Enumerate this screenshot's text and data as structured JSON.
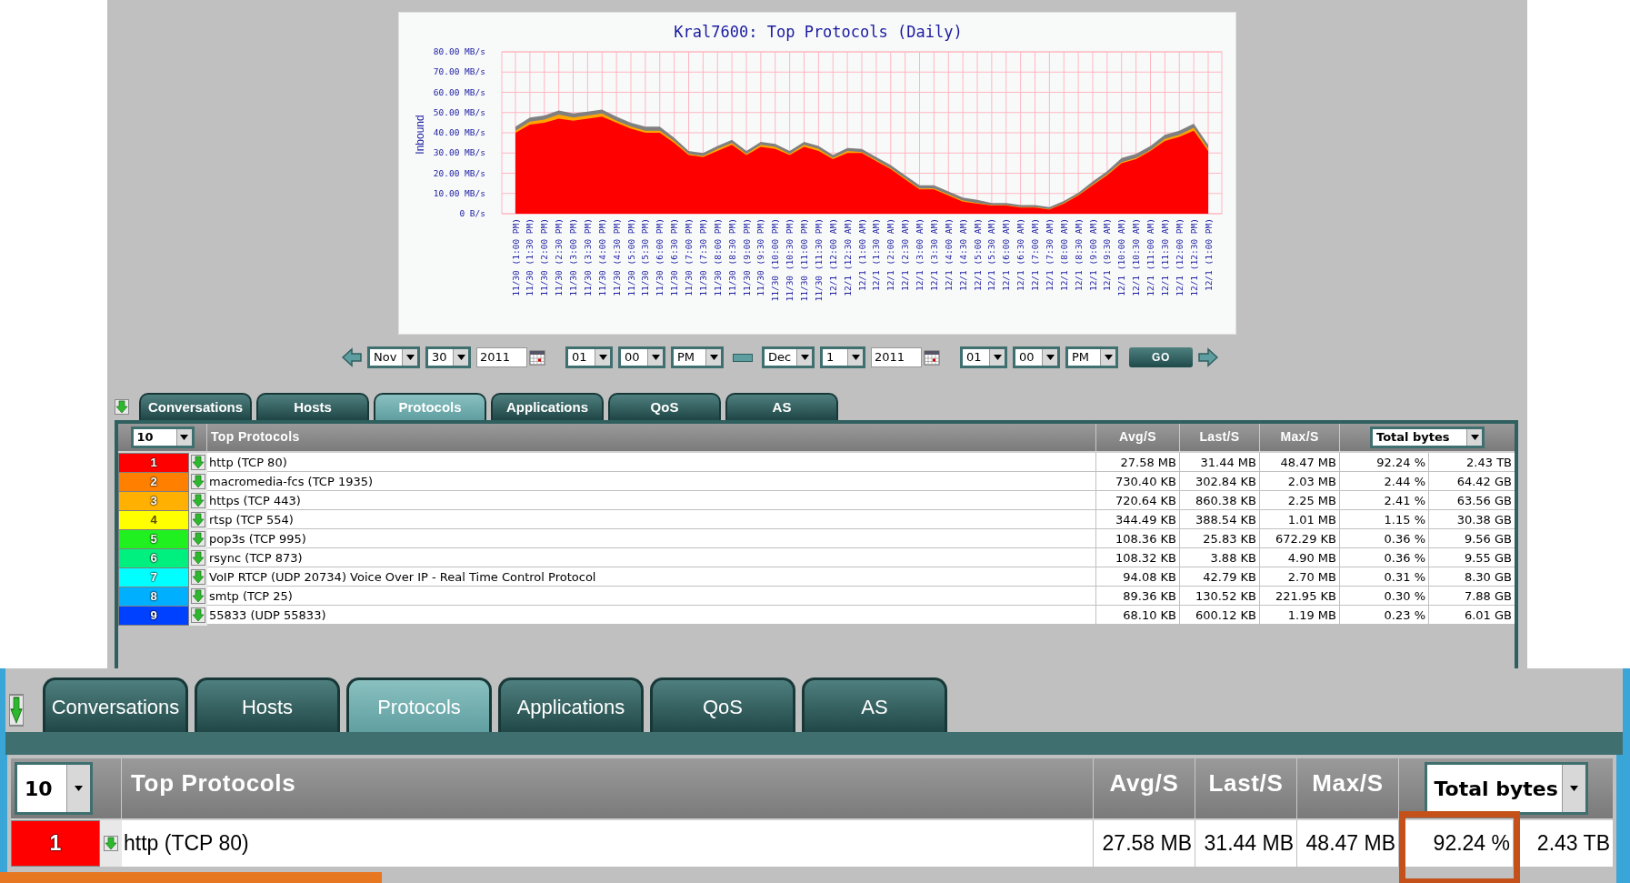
{
  "chart": {
    "chart_data": {
      "type": "area",
      "title": "Kral7600: Top Protocols (Daily)",
      "ylabel": "Inbound",
      "grid": true,
      "categories": [
        "11/30 (1:00 PM)",
        "11/30 (1:30 PM)",
        "11/30 (2:00 PM)",
        "11/30 (2:30 PM)",
        "11/30 (3:00 PM)",
        "11/30 (3:30 PM)",
        "11/30 (4:00 PM)",
        "11/30 (4:30 PM)",
        "11/30 (5:00 PM)",
        "11/30 (5:30 PM)",
        "11/30 (6:00 PM)",
        "11/30 (6:30 PM)",
        "11/30 (7:00 PM)",
        "11/30 (7:30 PM)",
        "11/30 (8:00 PM)",
        "11/30 (8:30 PM)",
        "11/30 (9:00 PM)",
        "11/30 (9:30 PM)",
        "11/30 (10:00 PM)",
        "11/30 (10:30 PM)",
        "11/30 (11:00 PM)",
        "11/30 (11:30 PM)",
        "12/1 (12:00 AM)",
        "12/1 (12:30 AM)",
        "12/1 (1:00 AM)",
        "12/1 (1:30 AM)",
        "12/1 (2:00 AM)",
        "12/1 (2:30 AM)",
        "12/1 (3:00 AM)",
        "12/1 (3:30 AM)",
        "12/1 (4:00 AM)",
        "12/1 (4:30 AM)",
        "12/1 (5:00 AM)",
        "12/1 (5:30 AM)",
        "12/1 (6:00 AM)",
        "12/1 (6:30 AM)",
        "12/1 (7:00 AM)",
        "12/1 (7:30 AM)",
        "12/1 (8:00 AM)",
        "12/1 (8:30 AM)",
        "12/1 (9:00 AM)",
        "12/1 (9:30 AM)",
        "12/1 (10:00 AM)",
        "12/1 (10:30 AM)",
        "12/1 (11:00 AM)",
        "12/1 (11:30 AM)",
        "12/1 (12:00 PM)",
        "12/1 (12:30 PM)",
        "12/1 (1:00 PM)"
      ],
      "series": [
        {
          "color": "#808080",
          "values": [
            43,
            47.5,
            48.5,
            51,
            49.5,
            50.5,
            51.5,
            48,
            45,
            43,
            43,
            37.5,
            31,
            30,
            33.5,
            36.5,
            31,
            35.5,
            34.5,
            31,
            35.5,
            33.5,
            29,
            32.5,
            32,
            28,
            24,
            19,
            14,
            14,
            11,
            8,
            6.8,
            5.3,
            5.3,
            4.3,
            4.3,
            3.3,
            6.3,
            10.3,
            16,
            21,
            27.5,
            29.5,
            33.5,
            39,
            41,
            44.5,
            34
          ]
        },
        {
          "color": "#ffa500",
          "values": [
            41,
            45.5,
            46.5,
            49,
            47.5,
            48.5,
            49.5,
            46,
            43,
            41,
            41,
            36,
            29.5,
            28.5,
            32,
            35,
            29.5,
            34,
            33,
            29.5,
            34,
            32,
            27.5,
            31,
            30.5,
            26.5,
            22.5,
            17.5,
            12.5,
            12.5,
            9.5,
            6.5,
            5.3,
            4.3,
            4.3,
            3.3,
            3.3,
            2.3,
            5.3,
            9.3,
            14.5,
            19.5,
            25.5,
            27.5,
            31.5,
            37,
            39,
            42.5,
            32
          ]
        },
        {
          "color": "#ff0000",
          "values": [
            40,
            44,
            45,
            47,
            46,
            47,
            48,
            45,
            42,
            40,
            40,
            35,
            29,
            28,
            31,
            34,
            29,
            33,
            32,
            29,
            33,
            31,
            27,
            30,
            30,
            26,
            22,
            17,
            12,
            12,
            9,
            6,
            5,
            4,
            4,
            3,
            3,
            2,
            5,
            9,
            14,
            19,
            25,
            27,
            31,
            36,
            38,
            41,
            31
          ]
        }
      ],
      "ylim": [
        0,
        80
      ],
      "yticks": [
        {
          "value": 0,
          "label": "0 B/s"
        },
        {
          "value": 10,
          "label": "10.00 MB/s"
        },
        {
          "value": 20,
          "label": "20.00 MB/s"
        },
        {
          "value": 30,
          "label": "30.00 MB/s"
        },
        {
          "value": 40,
          "label": "40.00 MB/s"
        },
        {
          "value": 50,
          "label": "50.00 MB/s"
        },
        {
          "value": 60,
          "label": "60.00 MB/s"
        },
        {
          "value": 70,
          "label": "70.00 MB/s"
        },
        {
          "value": 80,
          "label": "80.00 MB/s"
        }
      ]
    }
  },
  "date_range": {
    "start": {
      "month": "Nov",
      "day": "30",
      "year": "2011",
      "hour": "01",
      "minute": "00",
      "ampm": "PM"
    },
    "end": {
      "month": "Dec",
      "day": "1",
      "year": "2011",
      "hour": "01",
      "minute": "00",
      "ampm": "PM"
    },
    "go": "GO"
  },
  "tabs": [
    {
      "label": "Conversations",
      "selected": false
    },
    {
      "label": "Hosts",
      "selected": false
    },
    {
      "label": "Protocols",
      "selected": true
    },
    {
      "label": "Applications",
      "selected": false
    },
    {
      "label": "QoS",
      "selected": false
    },
    {
      "label": "AS",
      "selected": false
    }
  ],
  "table": {
    "rows_select": "10",
    "title": "Top Protocols",
    "columns": [
      "Avg/S",
      "Last/S",
      "Max/S"
    ],
    "sort_select": "Total bytes",
    "rows": [
      {
        "rank": "1",
        "color": "#ff0000",
        "name": "http (TCP 80)",
        "avg": "27.58 MB",
        "last": "31.44 MB",
        "max": "48.47 MB",
        "percent": "92.24 %",
        "total": "2.43 TB"
      },
      {
        "rank": "2",
        "color": "#ff8000",
        "name": "macromedia-fcs (TCP 1935)",
        "avg": "730.40 KB",
        "last": "302.84 KB",
        "max": "2.03 MB",
        "percent": "2.44 %",
        "total": "64.42 GB"
      },
      {
        "rank": "3",
        "color": "#ffb000",
        "name": "https (TCP 443)",
        "avg": "720.64 KB",
        "last": "860.38 KB",
        "max": "2.25 MB",
        "percent": "2.41 %",
        "total": "63.56 GB"
      },
      {
        "rank": "4",
        "color": "#ffff00",
        "name": "rtsp (TCP 554)",
        "avg": "344.49 KB",
        "last": "388.54 KB",
        "max": "1.01 MB",
        "percent": "1.15 %",
        "total": "30.38 GB"
      },
      {
        "rank": "5",
        "color": "#20f020",
        "name": "pop3s (TCP 995)",
        "avg": "108.36 KB",
        "last": "25.83 KB",
        "max": "672.29 KB",
        "percent": "0.36 %",
        "total": "9.56 GB"
      },
      {
        "rank": "6",
        "color": "#00f080",
        "name": "rsync (TCP 873)",
        "avg": "108.32 KB",
        "last": "3.88 KB",
        "max": "4.90 MB",
        "percent": "0.36 %",
        "total": "9.55 GB"
      },
      {
        "rank": "7",
        "color": "#00ffff",
        "name": "VoIP RTCP (UDP 20734) Voice Over IP - Real Time Control Protocol",
        "avg": "94.08 KB",
        "last": "42.79 KB",
        "max": "2.70 MB",
        "percent": "0.31 %",
        "total": "8.30 GB"
      },
      {
        "rank": "8",
        "color": "#00b0ff",
        "name": "smtp (TCP 25)",
        "avg": "89.36 KB",
        "last": "130.52 KB",
        "max": "221.95 KB",
        "percent": "0.30 %",
        "total": "7.88 GB"
      },
      {
        "rank": "9",
        "color": "#0040ff",
        "name": "55833 (UDP 55833)",
        "avg": "68.10 KB",
        "last": "600.12 KB",
        "max": "1.19 MB",
        "percent": "0.23 %",
        "total": "6.01 GB"
      }
    ]
  },
  "magnified_view": {
    "tabs": [
      {
        "label": "Conversations",
        "selected": false
      },
      {
        "label": "Hosts",
        "selected": false
      },
      {
        "label": "Protocols",
        "selected": true
      },
      {
        "label": "Applications",
        "selected": false
      },
      {
        "label": "QoS",
        "selected": false
      },
      {
        "label": "AS",
        "selected": false
      }
    ],
    "rows_select": "10",
    "title": "Top Protocols",
    "columns": [
      "Avg/S",
      "Last/S",
      "Max/S"
    ],
    "sort_select": "Total bytes",
    "rows": [
      {
        "rank": "1",
        "color": "#ff0000",
        "name": "http (TCP 80)",
        "avg": "27.58 MB",
        "last": "31.44 MB",
        "max": "48.47 MB",
        "percent": "92.24 %",
        "total": "2.43 TB",
        "percent_highlighted": true
      }
    ]
  }
}
